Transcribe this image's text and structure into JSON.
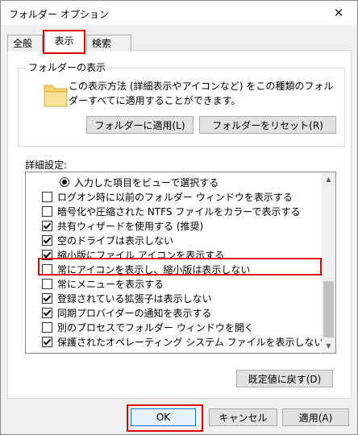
{
  "window": {
    "title": "フォルダー オプション"
  },
  "tabs": [
    {
      "label": "全般"
    },
    {
      "label": "表示"
    },
    {
      "label": "検索"
    }
  ],
  "folder_views": {
    "group_label": "フォルダーの表示",
    "description": "この表示方法 (詳細表示やアイコンなど) をこの種類のフォルダーすべてに適用することができます。",
    "apply_button": "フォルダーに適用(L)",
    "reset_button": "フォルダーをリセット(R)"
  },
  "advanced": {
    "label": "詳細設定:",
    "items": [
      {
        "type": "radio",
        "checked": true,
        "label": "入力した項目をビューで選択する"
      },
      {
        "type": "checkbox",
        "checked": false,
        "label": "ログオン時に以前のフォルダー ウィンドウを表示する"
      },
      {
        "type": "checkbox",
        "checked": false,
        "label": "暗号化や圧縮された NTFS ファイルをカラーで表示する"
      },
      {
        "type": "checkbox",
        "checked": true,
        "label": "共有ウィザードを使用する (推奨)"
      },
      {
        "type": "checkbox",
        "checked": true,
        "label": "空のドライブは表示しない"
      },
      {
        "type": "checkbox",
        "checked": true,
        "label": "縮小版にファイル アイコンを表示する"
      },
      {
        "type": "checkbox",
        "checked": false,
        "label": "常にアイコンを表示し、縮小版は表示しない"
      },
      {
        "type": "checkbox",
        "checked": false,
        "label": "常にメニューを表示する"
      },
      {
        "type": "checkbox",
        "checked": true,
        "label": "登録されている拡張子は表示しない"
      },
      {
        "type": "checkbox",
        "checked": true,
        "label": "同期プロバイダーの通知を表示する"
      },
      {
        "type": "checkbox",
        "checked": false,
        "label": "別のプロセスでフォルダー ウィンドウを開く"
      },
      {
        "type": "checkbox",
        "checked": true,
        "label": "保護されたオペレーティング システム ファイルを表示しない (推奨)"
      }
    ],
    "restore_button": "既定値に戻す(D)"
  },
  "footer": {
    "ok": "OK",
    "cancel": "キャンセル",
    "apply": "適用(A)"
  },
  "colors": {
    "highlight": "#e00000",
    "ok_focus": "#0078d7"
  }
}
